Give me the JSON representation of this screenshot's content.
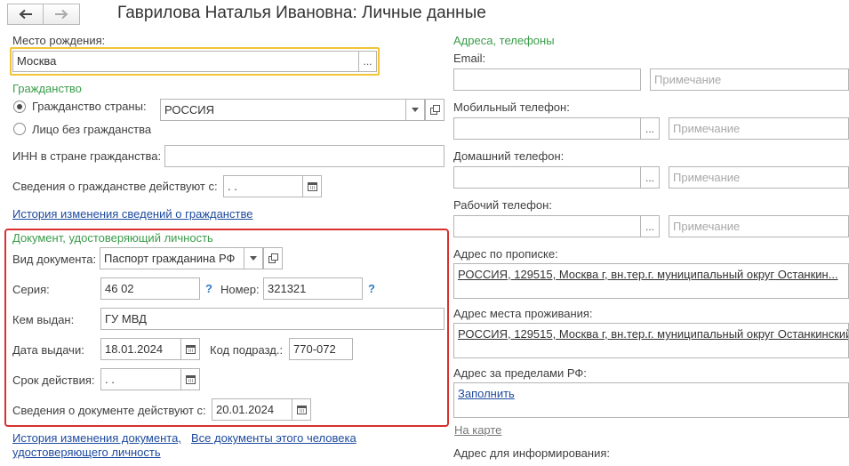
{
  "window": {
    "title": "Гаврилова Наталья Ивановна: Личные данные"
  },
  "nav": {
    "back_icon": "arrow-left-icon",
    "forward_icon": "arrow-right-icon"
  },
  "birthplace": {
    "label": "Место рождения:",
    "value": "Москва",
    "select": "..."
  },
  "citizenship": {
    "header": "Гражданство",
    "option_country": "Гражданство страны:",
    "option_stateless": "Лицо без гражданства",
    "country_value": "РОССИЯ",
    "inn_label": "ИНН в стране гражданства:",
    "inn_value": "",
    "valid_label": "Сведения о гражданстве действуют с:",
    "valid_value": " .  .",
    "history_link": "История изменения сведений о гражданстве"
  },
  "document": {
    "header": "Документ, удостоверяющий личность",
    "type_label": "Вид документа:",
    "type_value": "Паспорт гражданина РФ",
    "series_label": "Серия:",
    "series_value": "46 02",
    "number_label": "Номер:",
    "number_value": "321321",
    "help": "?",
    "issued_by_label": "Кем выдан:",
    "issued_by_value": "ГУ МВД",
    "issue_date_label": "Дата выдачи:",
    "issue_date_value": "18.01.2024",
    "code_label": "Код подразд.:",
    "code_value": "770-072",
    "expiry_label": "Срок действия:",
    "expiry_value": " .  .",
    "valid_label": "Сведения о документе действуют с:",
    "valid_value": "20.01.2024",
    "history_link_1": "История изменения документа,",
    "history_link_2": "удостоверяющего личность",
    "all_docs_link": "Все документы этого человека"
  },
  "contacts": {
    "header": "Адреса, телефоны",
    "email_label": "Email:",
    "note_placeholder": "Примечание",
    "mobile_label": "Мобильный телефон:",
    "home_label": "Домашний телефон:",
    "work_label": "Рабочий телефон:",
    "reg_addr_label": "Адрес по прописке:",
    "reg_addr_value": "РОССИЯ, 129515, Москва г, вн.тер.г. муниципальный округ Останкин...",
    "live_addr_label": "Адрес места проживания:",
    "live_addr_value": "РОССИЯ, 129515, Москва г, вн.тер.г. муниципальный округ Останкинский",
    "abroad_label": "Адрес за пределами РФ:",
    "fill_link": "Заполнить",
    "map_link": "На карте",
    "info_addr_label": "Адрес для информирования:",
    "select": "..."
  }
}
